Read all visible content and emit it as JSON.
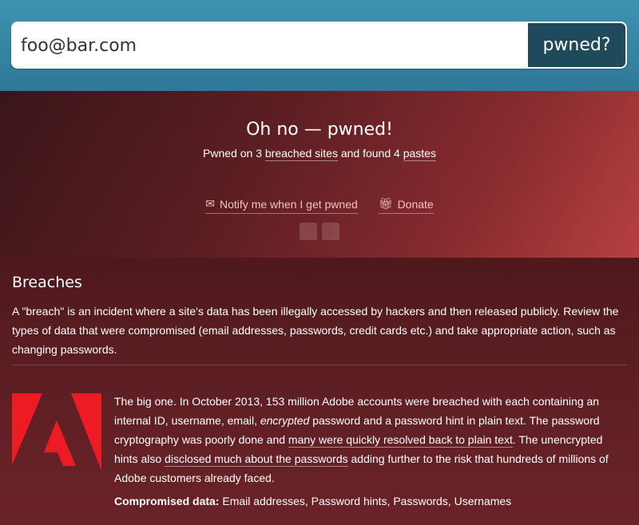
{
  "search": {
    "value": "foo@bar.com",
    "button_label": "pwned?"
  },
  "result": {
    "title": "Oh no — pwned!",
    "summary_prefix": "Pwned on 3",
    "breached_sites_link": "breached sites",
    "summary_middle": "and found 4",
    "pastes_link": "pastes",
    "notify_label": "Notify me when I get pwned",
    "donate_label": "Donate",
    "social": [
      "facebook-icon",
      "twitter-icon"
    ]
  },
  "breaches": {
    "heading": "Breaches",
    "intro": "A \"breach\" is an incident where a site's data has been illegally accessed by hackers and then released publicly. Review the types of data that were compromised (email addresses, passwords, credit cards etc.) and take appropriate action, such as changing passwords.",
    "items": [
      {
        "logo": "adobe-logo",
        "text_1": "The big one. In October 2013, 153 million Adobe accounts were breached with each containing an internal ID, username, email,",
        "text_em": "encrypted",
        "text_2": "password and a password hint in plain text. The password cryptography was poorly done and",
        "link_1": "many were quickly resolved back to plain text",
        "text_3": ". The unencrypted hints also",
        "link_2": "disclosed much about the passwords",
        "text_4": "adding further to the risk that hundreds of millions of Adobe customers already faced.",
        "compromised_label": "Compromised data:",
        "compromised_value": "Email addresses, Password hints, Passwords, Usernames"
      }
    ]
  },
  "colors": {
    "search_band": "#3f93b3",
    "search_button": "#1f4a5c",
    "pwned_red": "#b64042",
    "adobe_red": "#ed1c24"
  }
}
